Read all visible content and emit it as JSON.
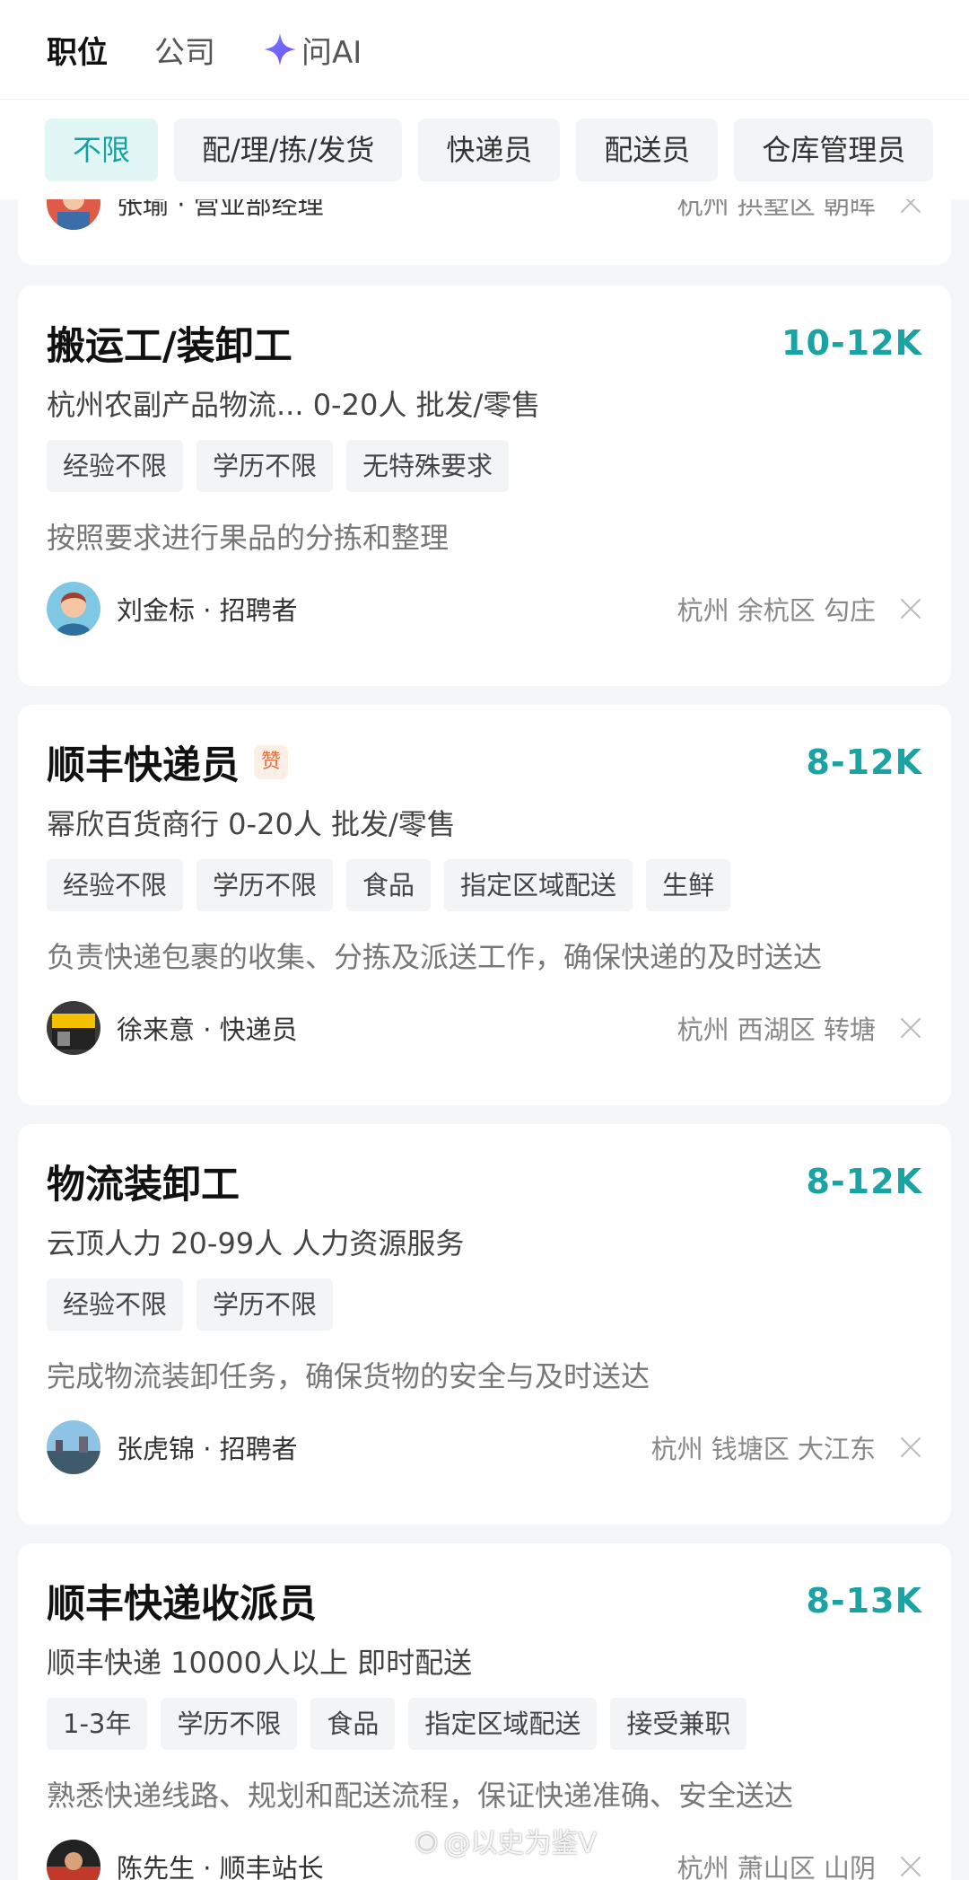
{
  "tabs": [
    {
      "label": "职位",
      "active": true
    },
    {
      "label": "公司",
      "active": false
    },
    {
      "label": "问AI",
      "icon": "sparkle-icon",
      "active": false
    }
  ],
  "filters": [
    {
      "label": "不限",
      "active": true
    },
    {
      "label": "配/理/拣/发货"
    },
    {
      "label": "快递员"
    },
    {
      "label": "配送员"
    },
    {
      "label": "仓库管理员"
    }
  ],
  "partial_card": {
    "recruiter": "张瑜 · 营业部经理",
    "location": "杭州 拱墅区 朝晖"
  },
  "jobs": [
    {
      "title": "搬运工/装卸工",
      "salary": "10-12K",
      "company": "杭州农副产品物流... 0-20人 批发/零售",
      "tags": [
        "经验不限",
        "学历不限",
        "无特殊要求"
      ],
      "description": "按照要求进行果品的分拣和整理",
      "recruiter": "刘金标 · 招聘者",
      "location": "杭州 余杭区 勾庄"
    },
    {
      "title": "顺丰快递员",
      "badge": "赞",
      "salary": "8-12K",
      "company": "幂欣百货商行 0-20人 批发/零售",
      "tags": [
        "经验不限",
        "学历不限",
        "食品",
        "指定区域配送",
        "生鲜"
      ],
      "description": "负责快递包裹的收集、分拣及派送工作，确保快递的及时送达",
      "recruiter": "徐来意 · 快递员",
      "location": "杭州 西湖区 转塘"
    },
    {
      "title": "物流装卸工",
      "salary": "8-12K",
      "company": "云顶人力 20-99人 人力资源服务",
      "tags": [
        "经验不限",
        "学历不限"
      ],
      "description": "完成物流装卸任务，确保货物的安全与及时送达",
      "recruiter": "张虎锦 · 招聘者",
      "location": "杭州 钱塘区 大江东"
    },
    {
      "title": "顺丰快递收派员",
      "salary": "8-13K",
      "company": "顺丰快递 10000人以上 即时配送",
      "tags": [
        "1-3年",
        "学历不限",
        "食品",
        "指定区域配送",
        "接受兼职"
      ],
      "description": "熟悉快递线路、规划和配送流程，保证快递准确、安全送达",
      "recruiter": "陈先生 · 顺丰站长",
      "location": "杭州 萧山区 山阴"
    }
  ],
  "watermark": "@以史为鉴V",
  "colors": {
    "accent": "#1aa3a3",
    "chip_active_bg": "#e3f6f6",
    "badge": "#e2703a"
  }
}
